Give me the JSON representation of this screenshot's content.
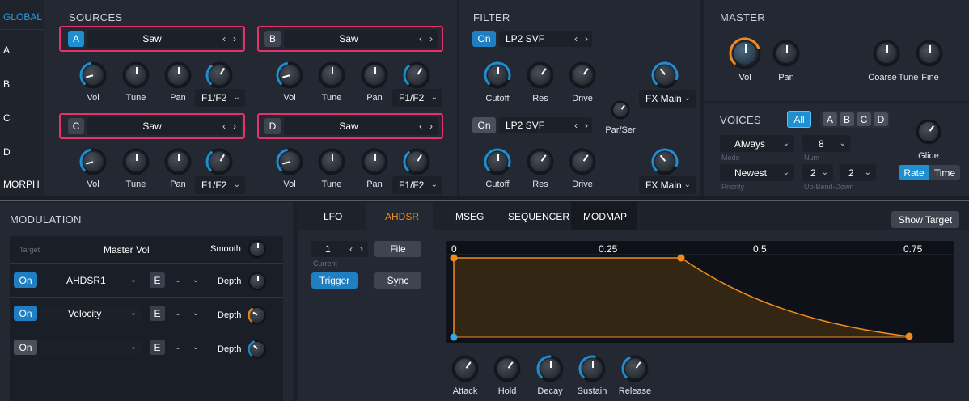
{
  "colors": {
    "accent": "#1f8fd0",
    "orange": "#f08a1c",
    "highlight": "#e5326b",
    "bg": "#1c2028",
    "panel": "#232833"
  },
  "sidebar": {
    "global": "GLOBAL",
    "items": [
      "A",
      "B",
      "C",
      "D",
      "MORPH"
    ]
  },
  "sources": {
    "header": "SOURCES",
    "osc": [
      {
        "badge": "A",
        "wave": "Saw",
        "filter_route": "F1/F2"
      },
      {
        "badge": "B",
        "wave": "Saw",
        "filter_route": "F1/F2"
      },
      {
        "badge": "C",
        "wave": "Saw",
        "filter_route": "F1/F2"
      },
      {
        "badge": "D",
        "wave": "Saw",
        "filter_route": "F1/F2"
      }
    ],
    "knob_labels": [
      "Vol",
      "Tune",
      "Pan"
    ]
  },
  "filter": {
    "header": "FILTER",
    "f1": {
      "state": "On",
      "type": "LP2 SVF",
      "fx": "FX Main"
    },
    "f2": {
      "state": "On",
      "type": "LP2 SVF",
      "fx": "FX Main"
    },
    "knob_labels": [
      "Cutoff",
      "Res",
      "Drive"
    ],
    "parser": "Par/Ser"
  },
  "master": {
    "header": "MASTER",
    "knobs": [
      "Vol",
      "Pan",
      "Coarse",
      "Tune",
      "Fine"
    ]
  },
  "voices": {
    "header": "VOICES",
    "all": "All",
    "groups": [
      "A",
      "B",
      "C",
      "D"
    ],
    "mode_value": "Always",
    "mode_label": "Mode",
    "num_value": "8",
    "num_label": "Num",
    "priority_value": "Newest",
    "priority_label": "Priority",
    "bend_up": "2",
    "bend_down": "2",
    "bend_label": "Up-Bend-Down",
    "glide": "Glide",
    "rate": "Rate",
    "time": "Time"
  },
  "modulation": {
    "header": "MODULATION",
    "target_label": "Target",
    "target_value": "Master Vol",
    "smooth": "Smooth",
    "rows": [
      {
        "state": "On",
        "source": "AHDSR1",
        "e": "E",
        "amount": "-",
        "depth": "Depth"
      },
      {
        "state": "On",
        "source": "Velocity",
        "e": "E",
        "amount": "-",
        "depth": "Depth"
      },
      {
        "state": "On",
        "source": "",
        "e": "E",
        "amount": "-",
        "depth": "Depth"
      }
    ]
  },
  "tabs": {
    "items": [
      "LFO",
      "AHDSR",
      "MSEG",
      "SEQUENCER",
      "MODMAP"
    ],
    "active": "AHDSR",
    "show_target": "Show Target"
  },
  "ahdsr": {
    "current_value": "1",
    "current_label": "Current",
    "file": "File",
    "trigger": "Trigger",
    "sync": "Sync",
    "time_marks": [
      "0",
      "0.25",
      "0.5",
      "0.75"
    ],
    "knobs": [
      "Attack",
      "Hold",
      "Decay",
      "Sustain",
      "Release"
    ]
  }
}
